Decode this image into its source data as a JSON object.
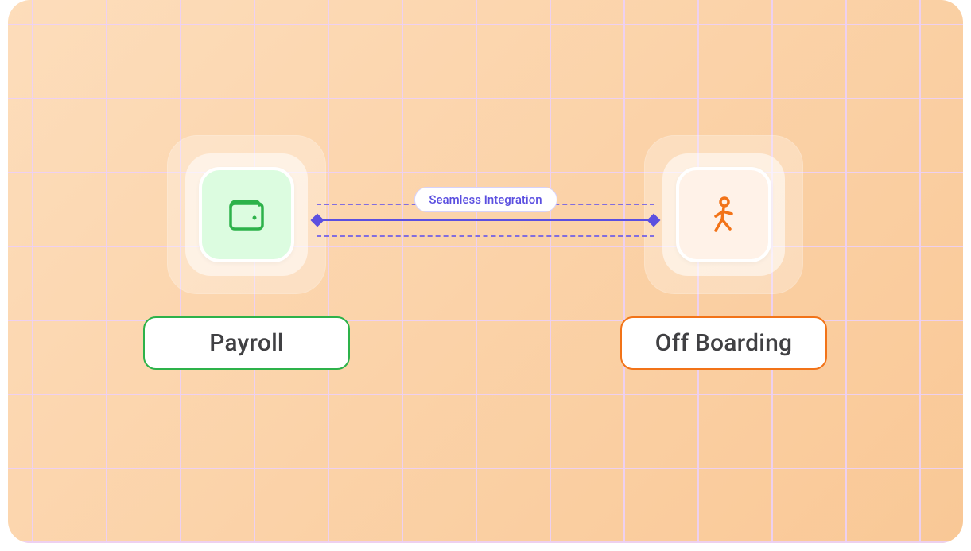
{
  "nodes": {
    "left": {
      "label": "Payroll",
      "icon": "wallet-icon",
      "accent": "#2DB24A"
    },
    "right": {
      "label": "Off Boarding",
      "icon": "person-walking-icon",
      "accent": "#F27318"
    }
  },
  "connector": {
    "badge": "Seamless Integration",
    "color": "#5B4FE0"
  }
}
